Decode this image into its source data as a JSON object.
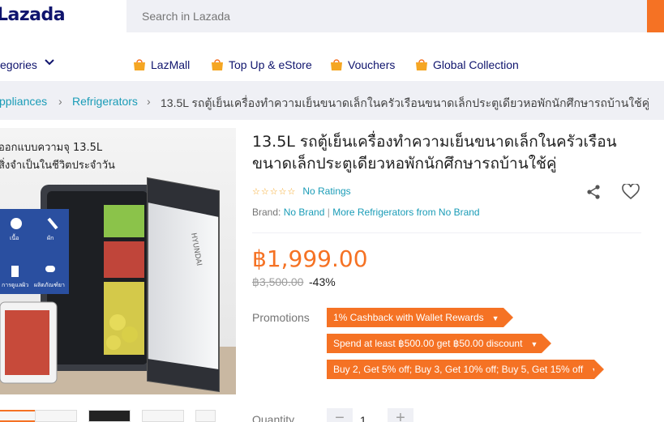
{
  "header": {
    "logo": "Lazada",
    "search_placeholder": "Search in Lazada"
  },
  "nav": {
    "categories": "egories",
    "links": [
      "LazMall",
      "Top Up & eStore",
      "Vouchers",
      "Global Collection"
    ]
  },
  "breadcrumb": {
    "items": [
      "ppliances",
      "Refrigerators"
    ],
    "current": "13.5L รถตู้เย็นเครื่องทำความเย็นขนาดเล็กในครัวเรือนขนาดเล็กประตูเดียวหอพักนักศึกษารถบ้านใช้คู่"
  },
  "product": {
    "title": "13.5L รถตู้เย็นเครื่องทำความเย็นขนาดเล็กในครัวเรือนขนาดเล็กประตูเดียวหอพักนักศึกษารถบ้านใช้คู่",
    "ratings_label": "No Ratings",
    "brand_prefix": "Brand:",
    "brand_name": "No Brand",
    "brand_more": "More Refrigerators from No Brand",
    "price": "฿1,999.00",
    "original_price": "฿3,500.00",
    "discount": "-43%",
    "promotions_label": "Promotions",
    "promotions": [
      "1% Cashback with Wallet Rewards",
      "Spend at least ฿500.00 get ฿50.00 discount",
      "Buy 2, Get 5% off; Buy 3, Get 10% off; Buy 5, Get 15% off"
    ],
    "quantity_label": "Quantity",
    "quantity": "1",
    "image_text": {
      "line1": "ออกแบบความจุ 13.5L",
      "line2": "สิ่งจำเป็นในชีวิตประจำวัน",
      "brand": "HYUNDAI",
      "icons": [
        "เนื้อ",
        "ผัก",
        "การดูแลผิว",
        "ผลิตภัณฑ์ยา"
      ]
    }
  },
  "colors": {
    "accent": "#f57224",
    "link": "#1a9cb7",
    "brand": "#0f146d"
  }
}
